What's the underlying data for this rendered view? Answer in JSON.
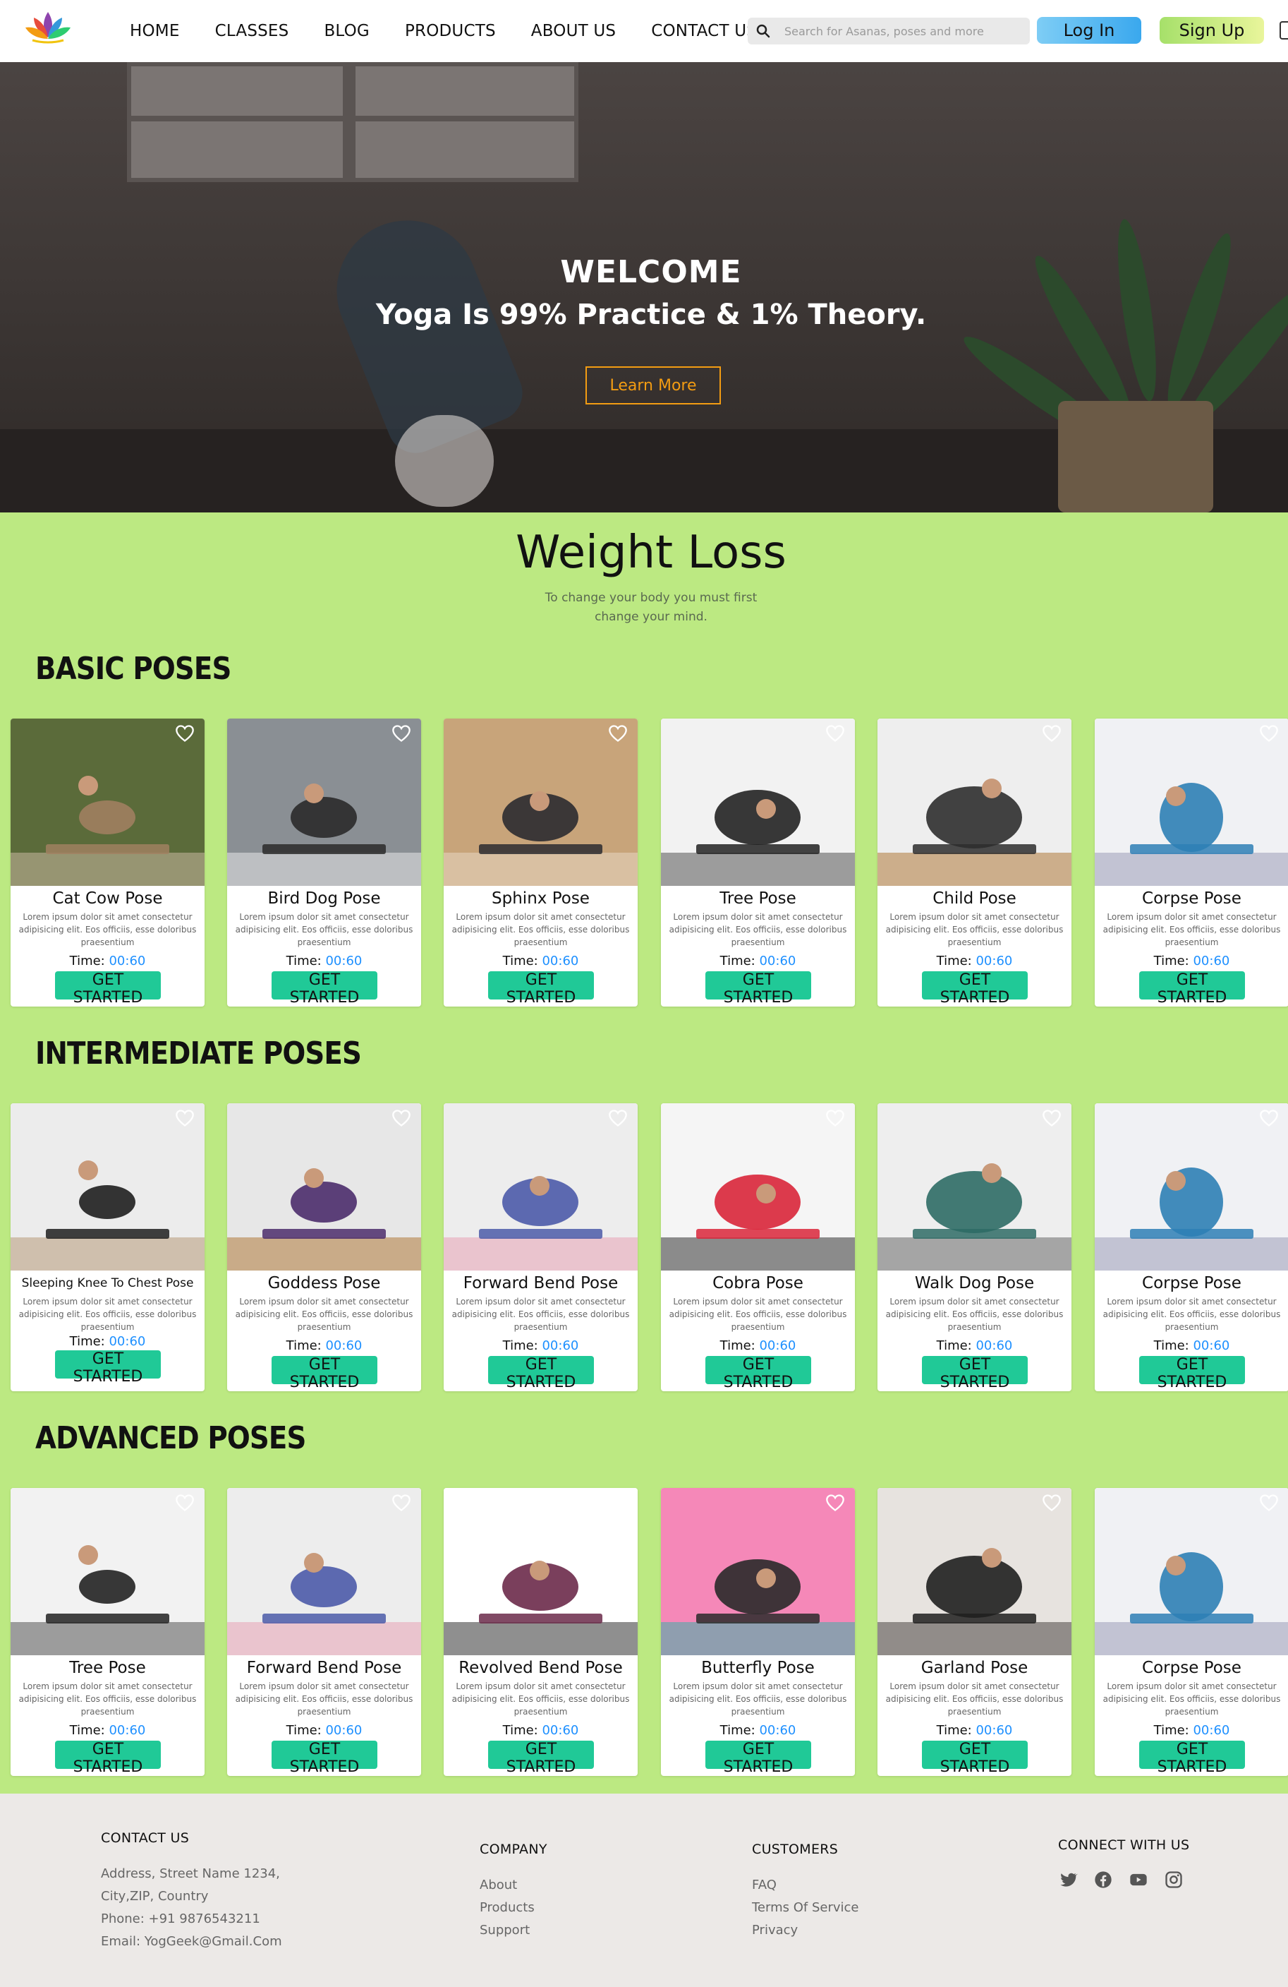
{
  "nav": {
    "links": [
      "HOME",
      "CLASSES",
      "BLOG",
      "PRODUCTS",
      "ABOUT US",
      "CONTACT US"
    ],
    "search_placeholder": "Search for Asanas, poses and more",
    "login_label": "Log In",
    "signup_label": "Sign Up"
  },
  "hero": {
    "title": "WELCOME",
    "subtitle": "Yoga Is 99% Practice & 1% Theory.",
    "cta": "Learn More"
  },
  "weight_loss": {
    "title": "Weight Loss",
    "subtitle_line1": "To change your body you must first",
    "subtitle_line2": "change your mind."
  },
  "sections": [
    {
      "title": "BASIC POSES",
      "cards": [
        {
          "name": "Cat Cow Pose",
          "desc": "Lorem ipsum dolor sit amet consectetur adipisicing elit. Eos officiis, esse doloribus praesentium",
          "time_label": "Time:",
          "time": "00:60",
          "cta": "GET STARTED"
        },
        {
          "name": "Bird Dog Pose",
          "desc": "Lorem ipsum dolor sit amet consectetur adipisicing elit. Eos officiis, esse doloribus praesentium",
          "time_label": "Time:",
          "time": "00:60",
          "cta": "GET STARTED"
        },
        {
          "name": "Sphinx Pose",
          "desc": "Lorem ipsum dolor sit amet consectetur adipisicing elit. Eos officiis, esse doloribus praesentium",
          "time_label": "Time:",
          "time": "00:60",
          "cta": "GET STARTED"
        },
        {
          "name": "Tree Pose",
          "desc": "Lorem ipsum dolor sit amet consectetur adipisicing elit. Eos officiis, esse doloribus praesentium",
          "time_label": "Time:",
          "time": "00:60",
          "cta": "GET STARTED"
        },
        {
          "name": "Child Pose",
          "desc": "Lorem ipsum dolor sit amet consectetur adipisicing elit. Eos officiis, esse doloribus praesentium",
          "time_label": "Time:",
          "time": "00:60",
          "cta": "GET STARTED"
        },
        {
          "name": "Corpse Pose",
          "desc": "Lorem ipsum dolor sit amet consectetur adipisicing elit. Eos officiis, esse doloribus praesentium",
          "time_label": "Time:",
          "time": "00:60",
          "cta": "GET STARTED"
        }
      ]
    },
    {
      "title": "INTERMEDIATE POSES",
      "cards": [
        {
          "name": "Sleeping Knee To Chest Pose",
          "desc": "Lorem ipsum dolor sit amet consectetur adipisicing elit. Eos officiis, esse doloribus praesentium",
          "time_label": "Time:",
          "time": "00:60",
          "cta": "GET STARTED"
        },
        {
          "name": "Goddess Pose",
          "desc": "Lorem ipsum dolor sit amet consectetur adipisicing elit. Eos officiis, esse doloribus praesentium",
          "time_label": "Time:",
          "time": "00:60",
          "cta": "GET STARTED"
        },
        {
          "name": "Forward Bend Pose",
          "desc": "Lorem ipsum dolor sit amet consectetur adipisicing elit. Eos officiis, esse doloribus praesentium",
          "time_label": "Time:",
          "time": "00:60",
          "cta": "GET STARTED"
        },
        {
          "name": "Cobra Pose",
          "desc": "Lorem ipsum dolor sit amet consectetur adipisicing elit. Eos officiis, esse doloribus praesentium",
          "time_label": "Time:",
          "time": "00:60",
          "cta": "GET STARTED"
        },
        {
          "name": "Walk Dog Pose",
          "desc": "Lorem ipsum dolor sit amet consectetur adipisicing elit. Eos officiis, esse doloribus praesentium",
          "time_label": "Time:",
          "time": "00:60",
          "cta": "GET STARTED"
        },
        {
          "name": "Corpse Pose",
          "desc": "Lorem ipsum dolor sit amet consectetur adipisicing elit. Eos officiis, esse doloribus praesentium",
          "time_label": "Time:",
          "time": "00:60",
          "cta": "GET STARTED"
        }
      ]
    },
    {
      "title": "ADVANCED POSES",
      "cards": [
        {
          "name": "Tree Pose",
          "desc": "Lorem ipsum dolor sit amet consectetur adipisicing elit. Eos officiis, esse doloribus praesentium",
          "time_label": "Time:",
          "time": "00:60",
          "cta": "GET STARTED"
        },
        {
          "name": "Forward Bend Pose",
          "desc": "Lorem ipsum dolor sit amet consectetur adipisicing elit. Eos officiis, esse doloribus praesentium",
          "time_label": "Time:",
          "time": "00:60",
          "cta": "GET STARTED"
        },
        {
          "name": "Revolved Bend Pose",
          "desc": "Lorem ipsum dolor sit amet consectetur adipisicing elit. Eos officiis, esse doloribus praesentium",
          "time_label": "Time:",
          "time": "00:60",
          "cta": "GET STARTED"
        },
        {
          "name": "Butterfly Pose",
          "desc": "Lorem ipsum dolor sit amet consectetur adipisicing elit. Eos officiis, esse doloribus praesentium",
          "time_label": "Time:",
          "time": "00:60",
          "cta": "GET STARTED"
        },
        {
          "name": "Garland Pose",
          "desc": "Lorem ipsum dolor sit amet consectetur adipisicing elit. Eos officiis, esse doloribus praesentium",
          "time_label": "Time:",
          "time": "00:60",
          "cta": "GET STARTED"
        },
        {
          "name": "Corpse Pose",
          "desc": "Lorem ipsum dolor sit amet consectetur adipisicing elit. Eos officiis, esse doloribus praesentium",
          "time_label": "Time:",
          "time": "00:60",
          "cta": "GET STARTED"
        }
      ]
    }
  ],
  "footer": {
    "contact": {
      "title": "CONTACT US",
      "address1": "Address, Street Name 1234,",
      "address2": "City,ZIP, Country",
      "phone": "Phone: +91 9876543211",
      "email": "Email: YogGeek@Gmail.Com"
    },
    "company": {
      "title": "COMPANY",
      "links": [
        "About",
        "Products",
        "Support"
      ]
    },
    "customers": {
      "title": "CUSTOMERS",
      "links": [
        "FAQ",
        "Terms Of Service",
        "Privacy"
      ]
    },
    "connect": {
      "title": "CONNECT WITH US",
      "icons": [
        "twitter-icon",
        "facebook-icon",
        "youtube-icon",
        "instagram-icon"
      ]
    }
  },
  "colors": {
    "green_bg": "#bce982",
    "button_teal": "#20c997",
    "time_blue": "#1e90ff",
    "login_blue": "#3aa8ee",
    "signup_green": "#a6e06a",
    "learn_more_orange": "#f39c12",
    "footer_bg": "#ece9e7"
  }
}
